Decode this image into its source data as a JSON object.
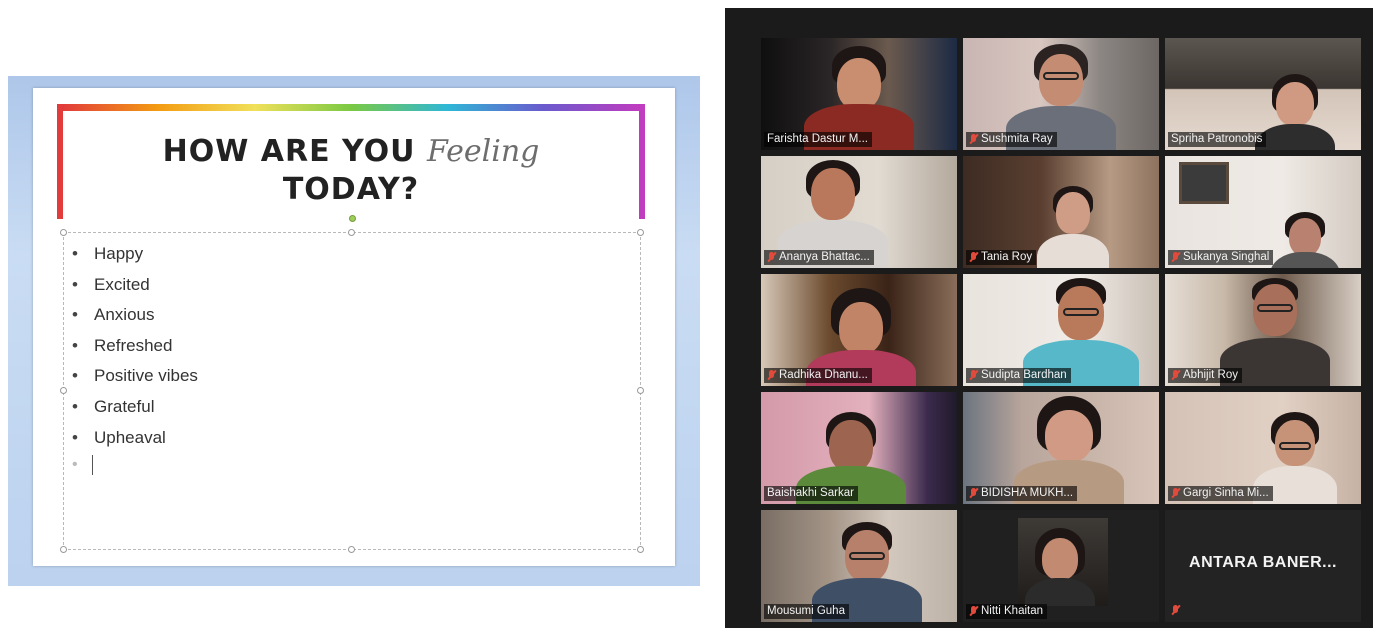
{
  "slide": {
    "title_part1": "HOW ARE YOU",
    "title_script": "Feeling",
    "title_part2": "TODAY?",
    "bullet_char": "•",
    "bullets": [
      "Happy",
      "Excited",
      "Anxious",
      "Refreshed",
      "Positive vibes",
      "Grateful",
      "Upheaval"
    ],
    "caret_text": "•"
  },
  "participants": [
    {
      "name": "Farishta Dastur M...",
      "muted": false
    },
    {
      "name": "Sushmita Ray",
      "muted": true
    },
    {
      "name": "Spriha Patronobis",
      "muted": false,
      "active_speaker": true
    },
    {
      "name": "Ananya Bhattac...",
      "muted": true
    },
    {
      "name": "Tania Roy",
      "muted": true
    },
    {
      "name": "Sukanya Singhal",
      "muted": true
    },
    {
      "name": "Radhika Dhanu...",
      "muted": true
    },
    {
      "name": "Sudipta Bardhan",
      "muted": true
    },
    {
      "name": "Abhijit Roy",
      "muted": true
    },
    {
      "name": "Baishakhi Sarkar",
      "muted": false
    },
    {
      "name": "BIDISHA MUKH...",
      "muted": true
    },
    {
      "name": "Gargi Sinha Mi...",
      "muted": true
    },
    {
      "name": "Mousumi Guha",
      "muted": false
    },
    {
      "name": "Nitti Khaitan",
      "muted": true
    },
    {
      "name": "ANTARA BANER...",
      "muted": true,
      "video_off": true
    }
  ],
  "colors": {
    "active_speaker_border": "#c8dd5a",
    "muted_icon": "#e24a3b",
    "grid_background": "#1b1b1b"
  }
}
